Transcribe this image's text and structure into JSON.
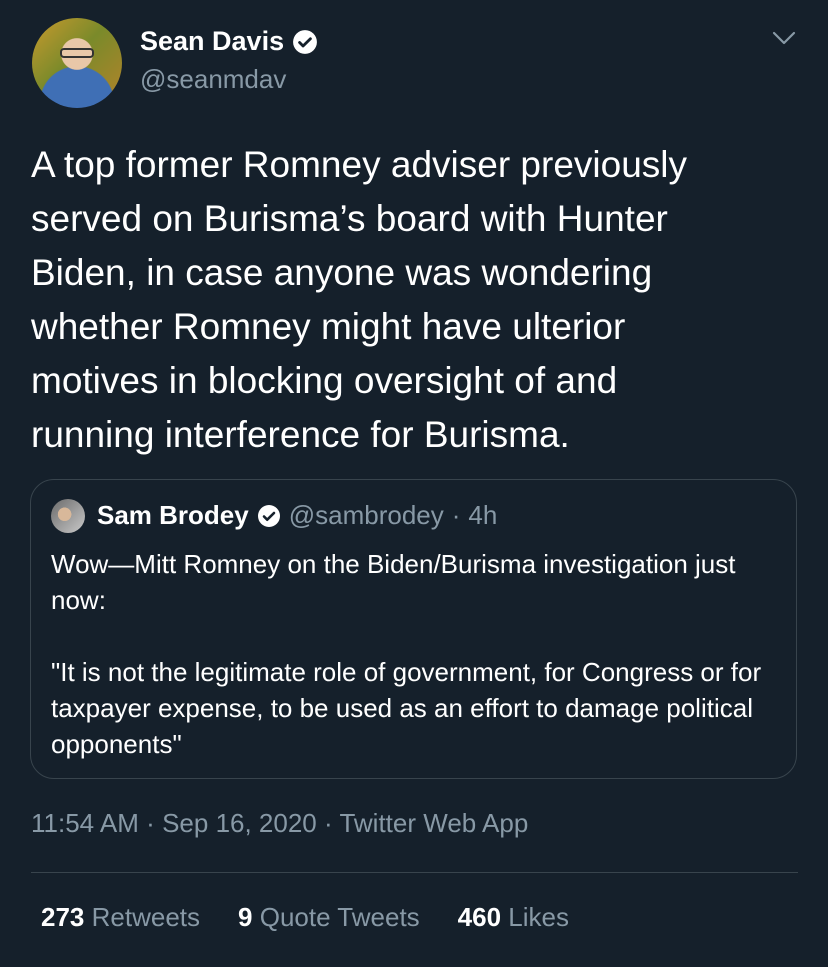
{
  "author": {
    "display_name": "Sean Davis",
    "handle": "@seanmdav"
  },
  "tweet": {
    "text": "A top former Romney adviser previously\nserved on Burisma’s board with Hunter\nBiden, in case anyone was wondering\nwhether Romney might have ulterior\nmotives in blocking oversight of and\nrunning interference for Burisma."
  },
  "quoted_tweet": {
    "display_name": "Sam Brodey",
    "handle": "@sambrodey",
    "separator": "·",
    "time_ago": "4h",
    "paragraphs": [
      "Wow—Mitt Romney on the Biden/Burisma investigation just now:",
      "\"It is not the legitimate role of government, for Congress or for taxpayer expense, to be used as an effort to damage political opponents\""
    ]
  },
  "meta": {
    "time": "11:54 AM",
    "date": "Sep 16, 2020",
    "source": "Twitter Web App",
    "separator": "·"
  },
  "stats": {
    "retweets": {
      "count": "273",
      "label": "Retweets"
    },
    "quote_tweets": {
      "count": "9",
      "label": "Quote Tweets"
    },
    "likes": {
      "count": "460",
      "label": "Likes"
    }
  },
  "icons": {
    "verified": "verified-badge-icon",
    "menu": "chevron-down-icon"
  },
  "colors": {
    "background": "#15202b",
    "secondary_text": "#8899a6",
    "border": "#38444d"
  }
}
